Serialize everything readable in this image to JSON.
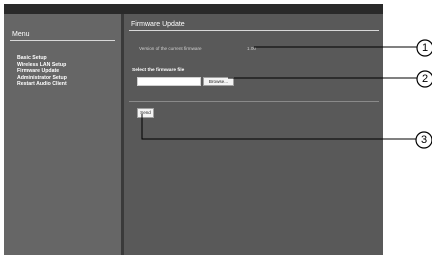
{
  "menu": {
    "title": "Menu",
    "items": [
      {
        "label": "Basic Setup"
      },
      {
        "label": "Wireless LAN Setup"
      },
      {
        "label": "Firmware Update"
      },
      {
        "label": "Administrator Setup"
      },
      {
        "label": "Restart Audio Client"
      }
    ]
  },
  "main": {
    "title": "Firmware Update",
    "version_label": "Version of the current firmware",
    "version_value": "1.00",
    "select_label": "Select the firmware file",
    "file_input_value": "",
    "browse_label": "Browse...",
    "send_label": "Send"
  },
  "callouts": [
    "1",
    "2",
    "3"
  ],
  "colors": {
    "background": "#595959",
    "sidebar": "#666666",
    "topbar": "#2a2a2a"
  }
}
